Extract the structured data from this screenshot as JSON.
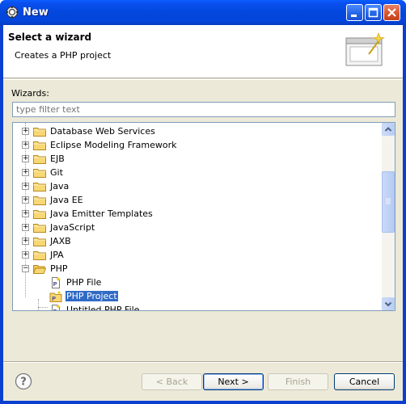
{
  "window": {
    "title": "New",
    "title_icon": "eclipse-gear-icon"
  },
  "titlebar_buttons": [
    {
      "name": "minimize-button",
      "icon": "minimize-icon"
    },
    {
      "name": "maximize-button",
      "icon": "maximize-icon"
    },
    {
      "name": "close-button",
      "icon": "close-icon"
    }
  ],
  "header": {
    "title": "Select a wizard",
    "description": "Creates a PHP project",
    "graphic_icon": "wizard-banner-icon"
  },
  "wizards": {
    "label": "Wizards:",
    "filter_placeholder": "type filter text",
    "filter_value": ""
  },
  "tree": {
    "items": [
      {
        "label": "Database Web Services",
        "expanded": false,
        "icon": "folder-icon"
      },
      {
        "label": "Eclipse Modeling Framework",
        "expanded": false,
        "icon": "folder-icon"
      },
      {
        "label": "EJB",
        "expanded": false,
        "icon": "folder-icon"
      },
      {
        "label": "Git",
        "expanded": false,
        "icon": "folder-icon"
      },
      {
        "label": "Java",
        "expanded": false,
        "icon": "folder-icon"
      },
      {
        "label": "Java EE",
        "expanded": false,
        "icon": "folder-icon"
      },
      {
        "label": "Java Emitter Templates",
        "expanded": false,
        "icon": "folder-icon"
      },
      {
        "label": "JavaScript",
        "expanded": false,
        "icon": "folder-icon"
      },
      {
        "label": "JAXB",
        "expanded": false,
        "icon": "folder-icon"
      },
      {
        "label": "JPA",
        "expanded": false,
        "icon": "folder-icon"
      },
      {
        "label": "PHP",
        "expanded": true,
        "icon": "folder-open-icon"
      }
    ],
    "php_children": [
      {
        "label": "PHP File",
        "icon": "php-file-icon",
        "selected": false
      },
      {
        "label": "PHP Project",
        "icon": "php-project-icon",
        "selected": true
      },
      {
        "label": "Untitled PHP File",
        "icon": "php-file-icon",
        "selected": false
      }
    ]
  },
  "buttons": {
    "back": "< Back",
    "next": "Next >",
    "finish": "Finish",
    "cancel": "Cancel"
  },
  "colors": {
    "titlebar": "#0a50ef",
    "selection": "#316ac5",
    "dialog_bg": "#ece9d8"
  }
}
